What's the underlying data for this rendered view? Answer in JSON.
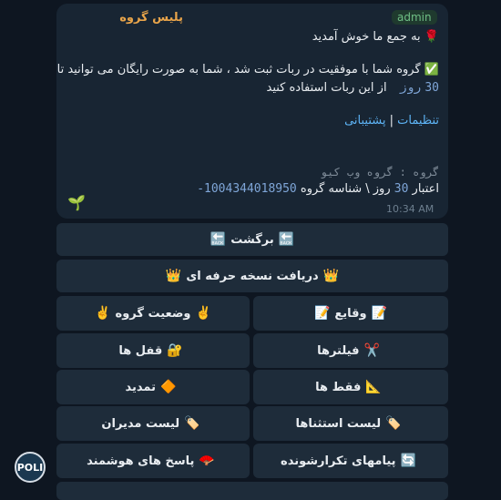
{
  "message": {
    "sender": "پلیس گروه",
    "role_badge": "admin",
    "welcome_icon": "🌹",
    "welcome": "به جمع ما خوش آمدید",
    "success_icon": "✅",
    "success_line1": "گروه شما با موفقیت در ربات ثبت شد ، شما به صورت رایگان می توانید تا",
    "trial_days": "30",
    "days_unit": "روز",
    "success_line2": "از این ربات استفاده کنید",
    "link_settings": "تنظیمات",
    "link_separator": "|",
    "link_support": "پشتیبانی",
    "group_title_line": "گروه : گروه وب کیو",
    "credit_prefix": "اعتبار",
    "credit_days": "30",
    "credit_mid": "روز \\ شناسه گروه",
    "group_id": "-1004344018950",
    "sprout_icon": "🌱",
    "time": "10:34 AM"
  },
  "keyboard": {
    "back": {
      "icon": "🔙",
      "label": "برگشت"
    },
    "pro": {
      "icon": "👑",
      "label": "دریافت نسخه حرفه ای"
    },
    "events": {
      "icon": "📝",
      "label": "وقایع"
    },
    "status": {
      "icon": "✌️",
      "label": "وضعیت گروه"
    },
    "filters": {
      "icon": "✂️",
      "label": "فیلترها"
    },
    "locks": {
      "icon": "🔐",
      "label": "قفل ها"
    },
    "only": {
      "icon": "📐",
      "label": "فقط ها"
    },
    "extend": {
      "icon": "🔶",
      "label": "تمدید"
    },
    "exceptions": {
      "icon": "🏷️",
      "label": "لیست استثناها"
    },
    "admins": {
      "icon": "🏷️",
      "label": "لیست مدیران"
    },
    "repeat": {
      "icon": "🔄",
      "label": "پیامهای تکرارشونده"
    },
    "smart": {
      "icon": "🪭",
      "label": "پاسخ های هوشمند"
    }
  },
  "avatar": {
    "text": "POLI"
  },
  "colors": {
    "background": "#0e1621",
    "bubble": "#182533",
    "button": "#1e2c3a",
    "sender": "#e8a44a",
    "link": "#5eb5f7"
  }
}
